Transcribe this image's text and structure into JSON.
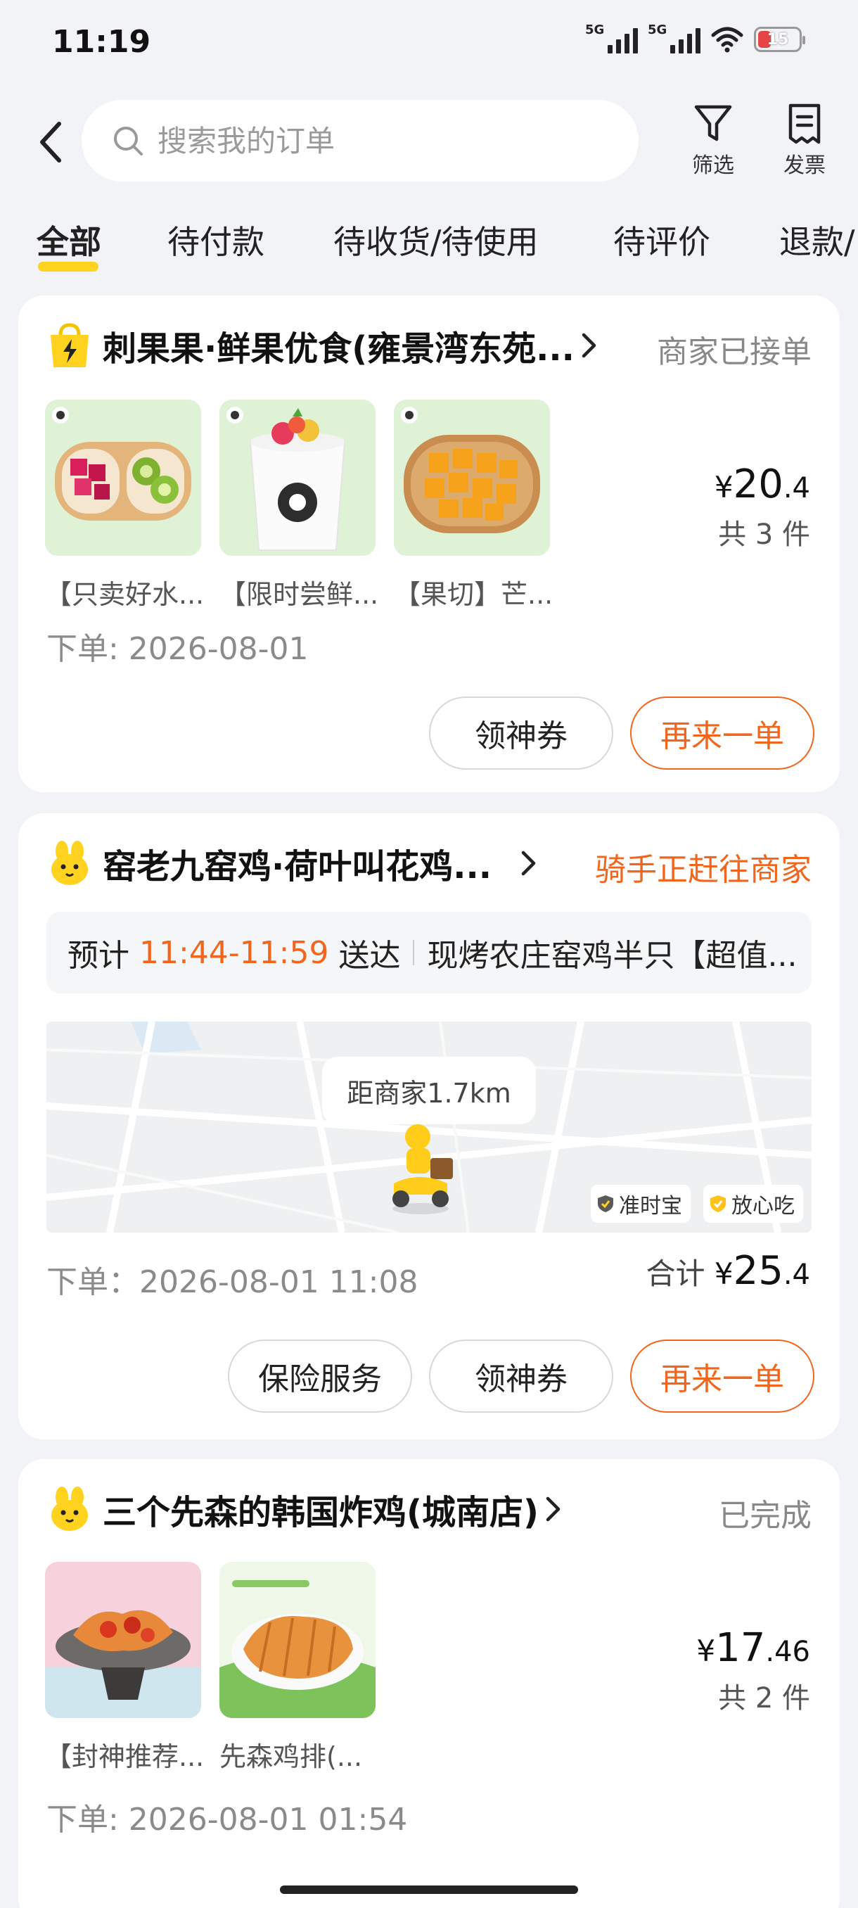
{
  "status_bar": {
    "time": "11:19",
    "sim1": "5G",
    "sim2": "5G",
    "battery": "15"
  },
  "header": {
    "search_placeholder": "搜索我的订单",
    "filter_label": "筛选",
    "invoice_label": "发票"
  },
  "tabs": [
    {
      "label": "全部",
      "active": true
    },
    {
      "label": "待付款"
    },
    {
      "label": "待收货/待使用"
    },
    {
      "label": "待评价"
    },
    {
      "label": "退款/"
    }
  ],
  "orders": [
    {
      "shop": "刺果果·鲜果优食(雍景湾东苑...",
      "status": "商家已接单",
      "items": [
        "【只卖好水...",
        "【限时尝鲜...",
        "【果切】芒..."
      ],
      "price_yen": "¥",
      "price_int": "20",
      "price_dec": ".4",
      "count": "共 3 件",
      "date": "下单: 2026-08-01",
      "buttons": [
        "领神券",
        "再来一单"
      ]
    },
    {
      "shop": "窑老九窑鸡·荷叶叫花鸡...",
      "status": "骑手正赶往商家",
      "eta_prefix": "预计",
      "eta_time": "11:44-11:59",
      "eta_suffix": "送达",
      "eta_item": "现烤农庄窑鸡半只【超值...",
      "map_distance": "距商家1.7km",
      "badge1": "准时宝",
      "badge2": "放心吃",
      "date": "下单：2026-08-01 11:08",
      "total_label": "合计",
      "total_yen": "¥",
      "total_int": "25",
      "total_dec": ".4",
      "buttons": [
        "保险服务",
        "领神券",
        "再来一单"
      ]
    },
    {
      "shop": "三个先森的韩国炸鸡(城南店)",
      "status": "已完成",
      "items": [
        "【封神推荐...",
        "先森鸡排(..."
      ],
      "price_yen": "¥",
      "price_int": "17",
      "price_dec": ".46",
      "count": "共 2 件",
      "date": "下单: 2026-08-01 01:54"
    }
  ]
}
